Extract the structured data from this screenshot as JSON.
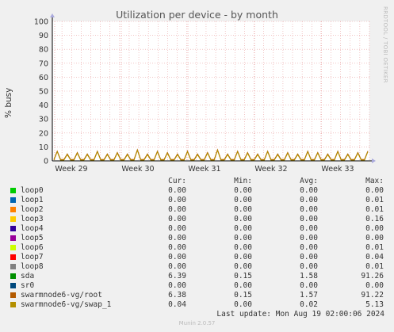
{
  "title": "Utilization per device - by month",
  "side_text": "RRDTOOL / TOBI OETIKER",
  "version": "Munin 2.0.57",
  "last_update": "Last update: Mon Aug 19 02:00:06 2024",
  "legend_headers": {
    "cur": "Cur:",
    "min": "Min:",
    "avg": "Avg:",
    "max": "Max:"
  },
  "colors": {
    "background": "#f0f0f0",
    "plot_bg": "#ffffff",
    "grid": "#e9a0a0",
    "axis": "#000000"
  },
  "legend": [
    {
      "name": "loop0",
      "color": "#00cc00",
      "cur": "0.00",
      "min": "0.00",
      "avg": "0.00",
      "max": "0.00"
    },
    {
      "name": "loop1",
      "color": "#0066b3",
      "cur": "0.00",
      "min": "0.00",
      "avg": "0.00",
      "max": "0.01"
    },
    {
      "name": "loop2",
      "color": "#ff8000",
      "cur": "0.00",
      "min": "0.00",
      "avg": "0.00",
      "max": "0.01"
    },
    {
      "name": "loop3",
      "color": "#ffcc00",
      "cur": "0.00",
      "min": "0.00",
      "avg": "0.00",
      "max": "0.16"
    },
    {
      "name": "loop4",
      "color": "#330099",
      "cur": "0.00",
      "min": "0.00",
      "avg": "0.00",
      "max": "0.00"
    },
    {
      "name": "loop5",
      "color": "#990099",
      "cur": "0.00",
      "min": "0.00",
      "avg": "0.00",
      "max": "0.00"
    },
    {
      "name": "loop6",
      "color": "#ccff00",
      "cur": "0.00",
      "min": "0.00",
      "avg": "0.00",
      "max": "0.01"
    },
    {
      "name": "loop7",
      "color": "#ff0000",
      "cur": "0.00",
      "min": "0.00",
      "avg": "0.00",
      "max": "0.04"
    },
    {
      "name": "loop8",
      "color": "#808080",
      "cur": "0.00",
      "min": "0.00",
      "avg": "0.00",
      "max": "0.01"
    },
    {
      "name": "sda",
      "color": "#008f00",
      "cur": "6.39",
      "min": "0.15",
      "avg": "1.58",
      "max": "91.26"
    },
    {
      "name": "sr0",
      "color": "#00487d",
      "cur": "0.00",
      "min": "0.00",
      "avg": "0.00",
      "max": "0.00"
    },
    {
      "name": "swarmnode6-vg/root",
      "color": "#b35a00",
      "cur": "6.38",
      "min": "0.15",
      "avg": "1.57",
      "max": "91.22"
    },
    {
      "name": "swarmnode6-vg/swap_1",
      "color": "#b38f00",
      "cur": "0.04",
      "min": "0.00",
      "avg": "0.02",
      "max": "5.13"
    }
  ],
  "chart_data": {
    "type": "line",
    "ylabel": "% busy",
    "ylim": [
      0,
      100
    ],
    "yticks": [
      0,
      10,
      20,
      30,
      40,
      50,
      60,
      70,
      80,
      90,
      100
    ],
    "xticks": [
      "Week 29",
      "Week 30",
      "Week 31",
      "Week 32",
      "Week 33"
    ],
    "grid": true,
    "series": [
      {
        "name": "swarmnode6-vg/root",
        "color": "#b35a00",
        "values": [
          1,
          7,
          1,
          1,
          5,
          1,
          1,
          6,
          1,
          1,
          5,
          1,
          1,
          7,
          1,
          1,
          5,
          1,
          1,
          6,
          1,
          1,
          5,
          1,
          1,
          8,
          1,
          1,
          5,
          1,
          1,
          7,
          1,
          1,
          6,
          1,
          1,
          5,
          1,
          1,
          7,
          1,
          1,
          5,
          1,
          1,
          6,
          1,
          1,
          8,
          1,
          1,
          5,
          1,
          1,
          7,
          1,
          1,
          6,
          1,
          1,
          5,
          1,
          1,
          7,
          1,
          1,
          5,
          1,
          1,
          6,
          1,
          1,
          5,
          1,
          1,
          7,
          1,
          1,
          6,
          1,
          1,
          5,
          1,
          1,
          7,
          1,
          1,
          5,
          1,
          1,
          6,
          1,
          1,
          7
        ]
      },
      {
        "name": "swarmnode6-vg/swap_1",
        "color": "#b38f00",
        "values": [
          0.5,
          6.5,
          0.5,
          0.5,
          4.5,
          0.5,
          0.5,
          5.5,
          0.5,
          0.5,
          4.5,
          0.5,
          0.5,
          6.5,
          0.5,
          0.5,
          4.5,
          0.5,
          0.5,
          5.5,
          0.5,
          0.5,
          4.5,
          0.5,
          0.5,
          7.5,
          0.5,
          0.5,
          4.5,
          0.5,
          0.5,
          6.5,
          0.5,
          0.5,
          5.5,
          0.5,
          0.5,
          4.5,
          0.5,
          0.5,
          6.5,
          0.5,
          0.5,
          4.5,
          0.5,
          0.5,
          5.5,
          0.5,
          0.5,
          7.5,
          0.5,
          0.5,
          4.5,
          0.5,
          0.5,
          6.5,
          0.5,
          0.5,
          5.5,
          0.5,
          0.5,
          4.5,
          0.5,
          0.5,
          6.5,
          0.5,
          0.5,
          4.5,
          0.5,
          0.5,
          5.5,
          0.5,
          0.5,
          4.5,
          0.5,
          0.5,
          6.5,
          0.5,
          0.5,
          5.5,
          0.5,
          0.5,
          4.5,
          0.5,
          0.5,
          6.5,
          0.5,
          0.5,
          4.5,
          0.5,
          0.5,
          5.5,
          0.5,
          0.5,
          6.5
        ]
      }
    ]
  }
}
